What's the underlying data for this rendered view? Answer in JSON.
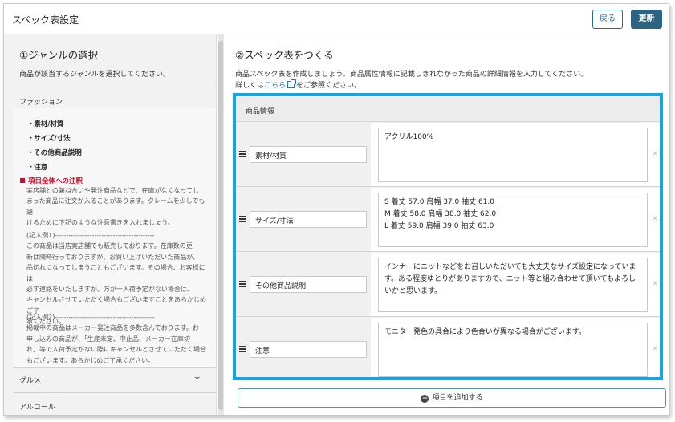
{
  "header": {
    "title": "スペック表設定",
    "back_label": "戻る",
    "update_label": "更新"
  },
  "left": {
    "title": "①ジャンルの選択",
    "desc": "商品が該当するジャンルを選択してください。",
    "genres": [
      {
        "label": "ファッション",
        "expanded": true
      },
      {
        "label": "グルメ",
        "expanded": false
      },
      {
        "label": "アルコール",
        "expanded": false
      }
    ],
    "fashion_items": [
      "素材/材質",
      "サイズ/寸法",
      "その他商品説明",
      "注意"
    ],
    "warning_title": "項目全体への注釈",
    "warning_lines": [
      "実店舗との兼ね合いや発注商品などで、在庫がなくなってし",
      "まった商品に注文が入ることがあります。クレームを少しでも避",
      "けるために下記のような注意書きを入れましょう。"
    ],
    "example1_lines": [
      "(記入例1)-------------------------------------------",
      "この商品は当店実店舗でも販売しております。在庫数の更",
      "新は随時行っておりますが、お買い上げいただいた商品が、",
      "品切れになってしまうこともございます。その場合、お客様には",
      "必ず連絡をいたしますが、万が一入荷予定がない場合は、",
      "キャンセルさせていただく場合もございますことをあらかじめご了",
      "承ください。"
    ],
    "example2_lines": [
      "(記入例2)-------------------------------------------",
      "掲載中の商品はメーカー発注商品を多数含んでおります。お",
      "申し込みの商品が、「生産未定、中止品、メーカー在庫切",
      "れ」等で入荷予定がない際にキャンセルとさせていただく場合",
      "もございます。あらかじめご了承ください。"
    ]
  },
  "right": {
    "title": "②スペック表をつくる",
    "desc1": "商品スペック表を作成しましょう。商品属性情報に記載しきれなかった商品の詳細情報を入力してください。",
    "desc2_prefix": "詳しくは",
    "desc2_link": "こちら",
    "desc2_suffix": "をご参照ください。",
    "table_header": "商品情報",
    "rows": [
      {
        "name": "素材/材質",
        "value": "アクリル100%"
      },
      {
        "name": "サイズ/寸法",
        "value": "S 着丈 57.0 肩幅 37.0 袖丈 61.0\nM 着丈 58.0 肩幅 38.0 袖丈 62.0\nL 着丈 59.0 肩幅 39.0 袖丈 63.0"
      },
      {
        "name": "その他商品説明",
        "value": "インナーにニットなどをお召しいただいても大丈夫なサイズ設定になっています。ある程度ゆとりがありますので、ニット等と組み合わせて頂いてもよろしいかと思います。"
      },
      {
        "name": "注意",
        "value": "モニター発色の具合により色合いが異なる場合がございます。"
      }
    ],
    "delete_glyph": "×",
    "add_label": "項目を追加する",
    "add_glyph": "+"
  },
  "colors": {
    "accent": "#2c6383",
    "highlight": "#15a5e0",
    "warning": "#c8102e",
    "link": "#1f78c4"
  },
  "icons": [
    "drag-handle-icon",
    "external-link-icon",
    "chevron-down-icon",
    "plus-circle-icon",
    "close-icon"
  ]
}
